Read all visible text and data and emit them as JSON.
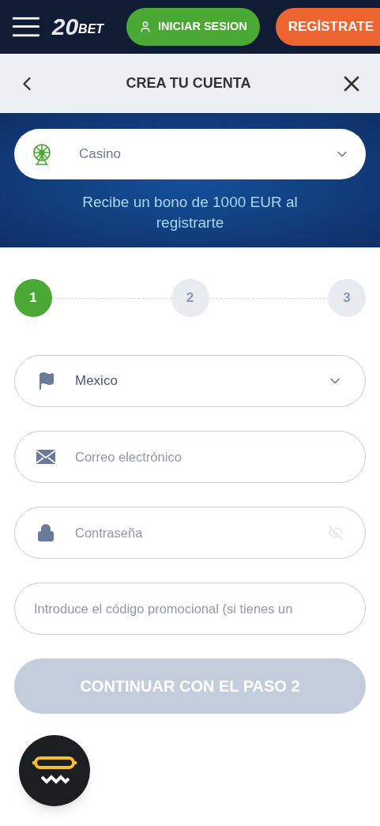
{
  "header": {
    "logo": {
      "number": "20",
      "word": "BET"
    },
    "login_button": "INICIAR SESION",
    "register_button": "REGİSTRATE"
  },
  "title_bar": {
    "title": "CREA TU CUENTA"
  },
  "banner": {
    "product_select": {
      "value": "Casino"
    },
    "bonus_text": "Recibe un bono de 1000 EUR al registrarte"
  },
  "steps": [
    {
      "label": "1",
      "selected": true
    },
    {
      "label": "2",
      "selected": false
    },
    {
      "label": "3",
      "selected": false
    }
  ],
  "fields": [
    {
      "kind": "country",
      "value": "Mexico"
    },
    {
      "kind": "email",
      "placeholder": "Correo electrónico"
    },
    {
      "kind": "password",
      "placeholder": "Contraseña"
    },
    {
      "kind": "promo",
      "placeholder": "Introduce el código promocional (si tienes un"
    }
  ],
  "continue_button": {
    "label": "CONTINUAR CON EL PASO 2",
    "disabled": true
  }
}
